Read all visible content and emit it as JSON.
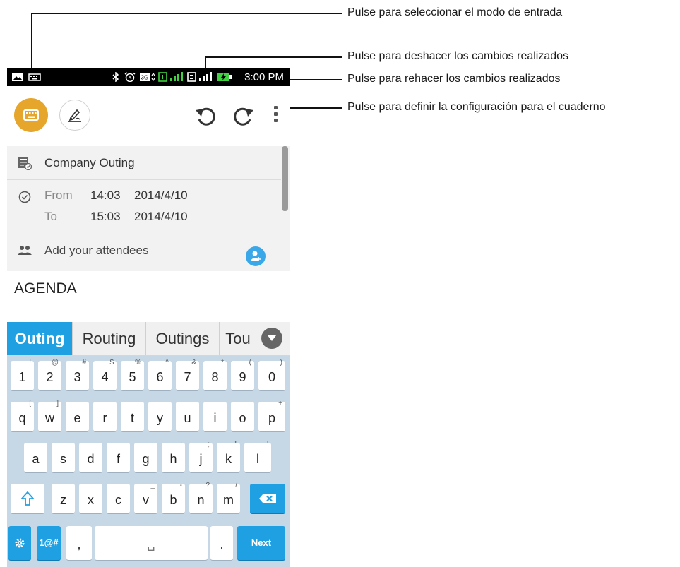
{
  "status_bar": {
    "time": "3:00 PM"
  },
  "app_bar": {
    "input_mode_icon": "keyboard-icon",
    "handwriting_icon": "pen-icon",
    "undo_icon": "undo-icon",
    "redo_icon": "redo-icon",
    "menu_icon": "more-vert-icon",
    "accent_color": "#e6a52b"
  },
  "event": {
    "title": "Company Outing",
    "from_label": "From",
    "from_time": "14:03",
    "from_date": "2014/4/10",
    "to_label": "To",
    "to_time": "15:03",
    "to_date": "2014/4/10",
    "attendees_placeholder": "Add your attendees"
  },
  "note": {
    "text": "AGENDA"
  },
  "suggestions": [
    "Outing",
    "Routing",
    "Outings",
    "Tou"
  ],
  "keyboard": {
    "row1": [
      [
        "1",
        "!"
      ],
      [
        "2",
        "@"
      ],
      [
        "3",
        "#"
      ],
      [
        "4",
        "$"
      ],
      [
        "5",
        "%"
      ],
      [
        "6",
        "^"
      ],
      [
        "7",
        "&"
      ],
      [
        "8",
        "*"
      ],
      [
        "9",
        "("
      ],
      [
        "0",
        ")"
      ]
    ],
    "row2": [
      [
        "q",
        "["
      ],
      [
        "w",
        "]"
      ],
      [
        "e",
        ""
      ],
      [
        "r",
        ""
      ],
      [
        "t",
        ""
      ],
      [
        "y",
        ""
      ],
      [
        "u",
        ""
      ],
      [
        "i",
        ""
      ],
      [
        "o",
        ""
      ],
      [
        "p",
        "+"
      ]
    ],
    "row3": [
      [
        "a",
        ""
      ],
      [
        "s",
        ""
      ],
      [
        "d",
        ""
      ],
      [
        "f",
        ""
      ],
      [
        "g",
        ""
      ],
      [
        "h",
        ":"
      ],
      [
        "j",
        ";"
      ],
      [
        "k",
        "\""
      ],
      [
        "l",
        "'"
      ]
    ],
    "row4": [
      [
        "z",
        ""
      ],
      [
        "x",
        ""
      ],
      [
        "c",
        ""
      ],
      [
        "v",
        "_"
      ],
      [
        "b",
        "-"
      ],
      [
        "n",
        "?"
      ],
      [
        "m",
        "/"
      ]
    ],
    "symbols_label": "1@#",
    "comma_label": ",",
    "period_label": ".",
    "space_symbol": "␣",
    "next_label": "Next",
    "accent_color": "#1ea0e3"
  },
  "callouts": {
    "input_mode": "Pulse para seleccionar el modo de entrada",
    "undo": "Pulse para deshacer los cambios realizados",
    "redo": "Pulse para rehacer los cambios realizados",
    "settings": "Pulse para definir la configuración para el cuaderno"
  }
}
